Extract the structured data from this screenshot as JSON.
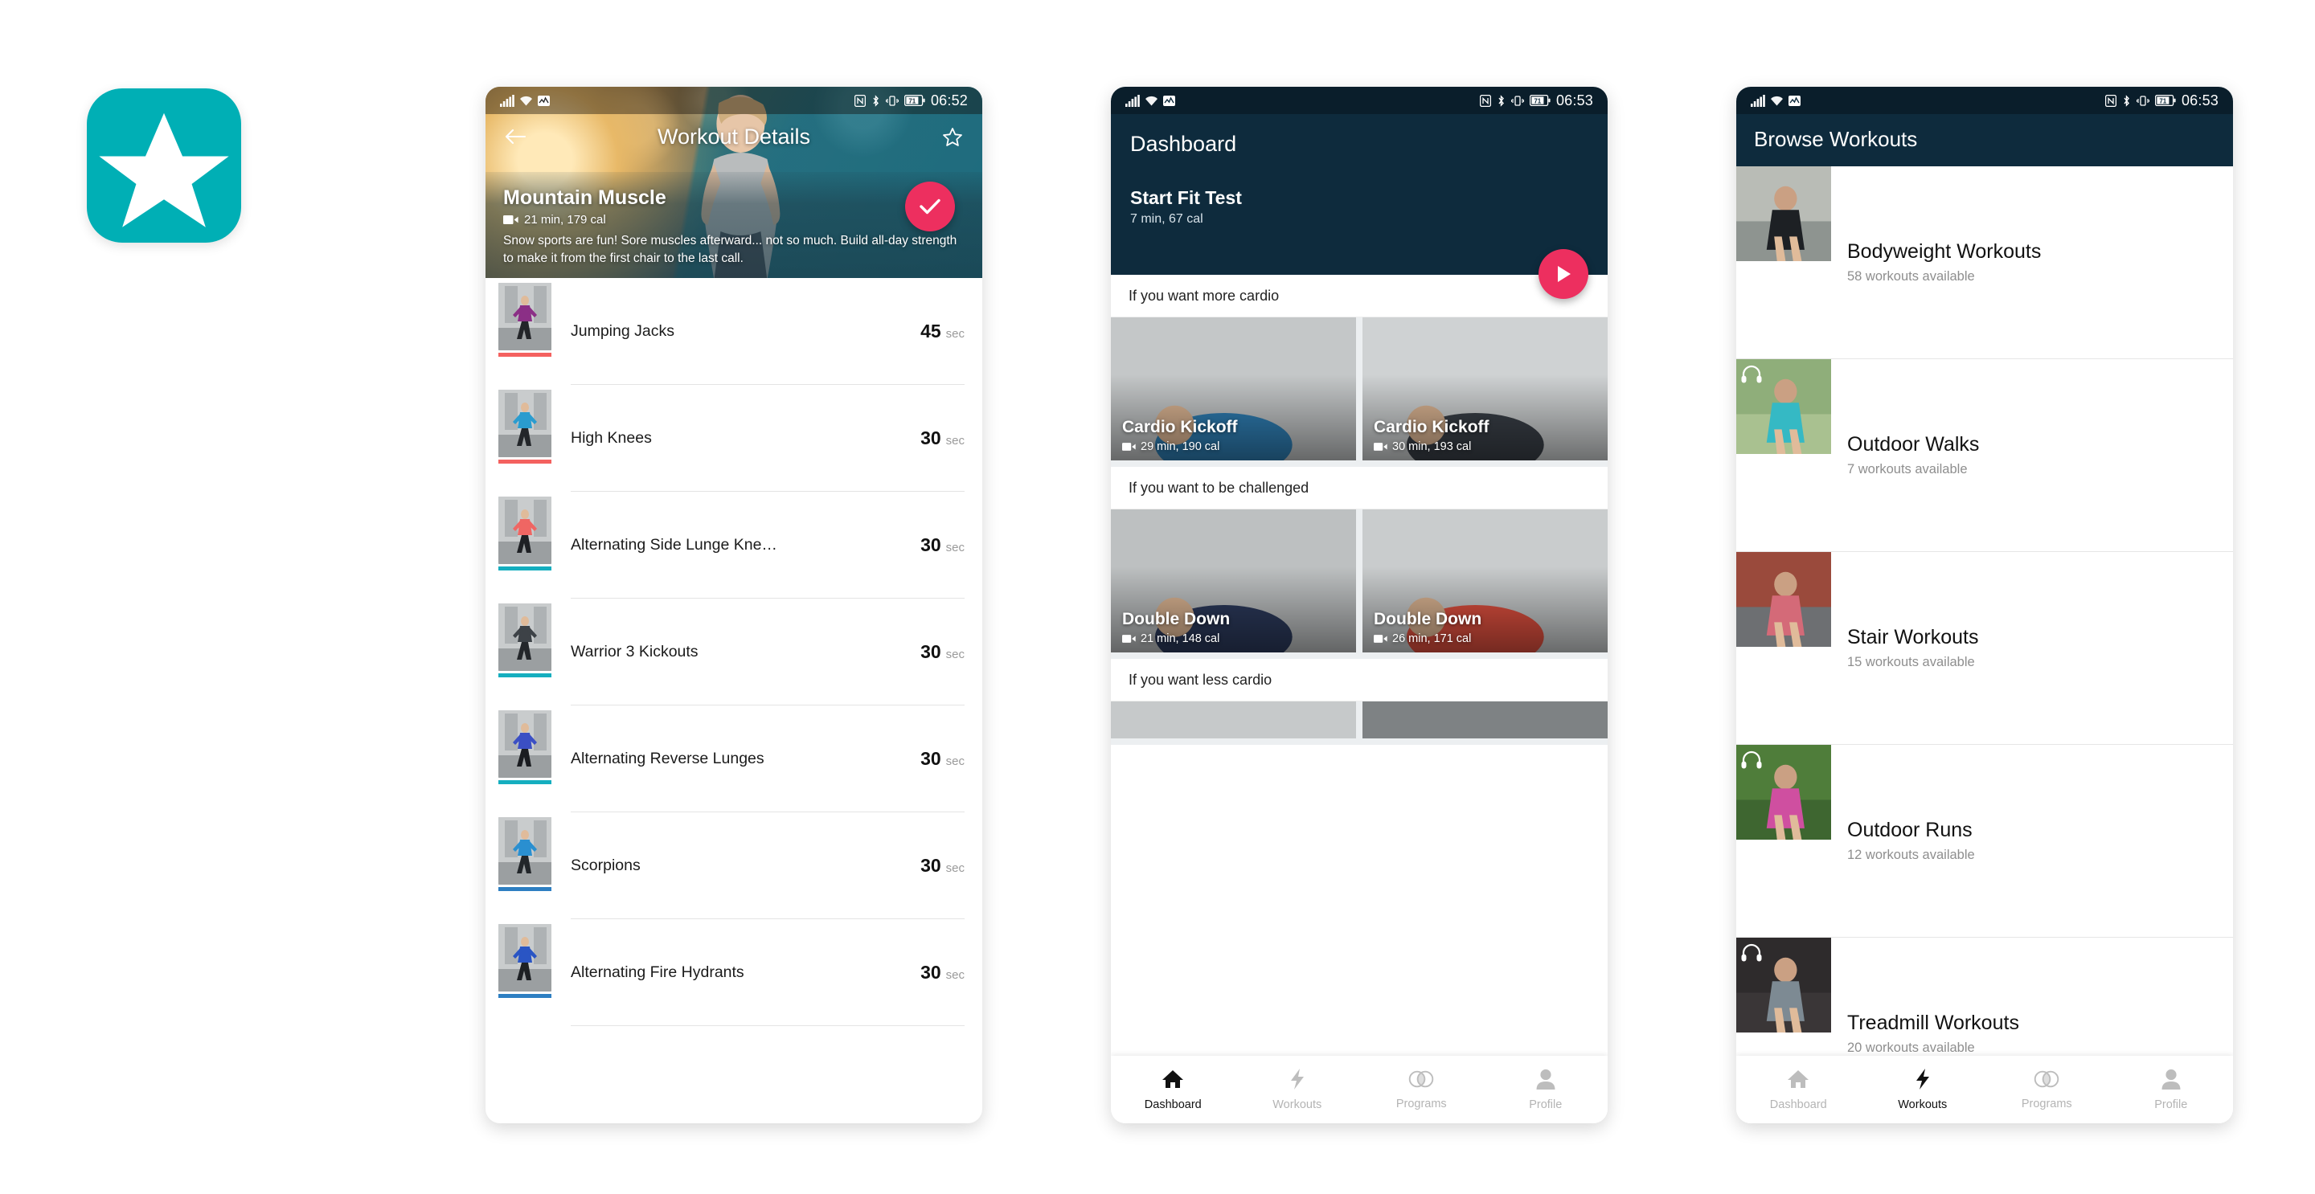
{
  "app_icon": {
    "name": "star-app-icon",
    "color": "#00AFB5",
    "glyph": "star"
  },
  "colors": {
    "accent_pink": "#ED2F5F",
    "navy": "#0E2B3D",
    "teal": "#00AFB5",
    "coral": "#F25B5B"
  },
  "phone1": {
    "status_bar": {
      "time": "06:52",
      "battery": "71",
      "icons": [
        "signal-icon",
        "wifi-icon",
        "data-icon",
        "nfc-icon",
        "bluetooth-icon",
        "vibrate-icon",
        "battery-icon"
      ]
    },
    "header": {
      "title": "Workout Details",
      "back": "back-arrow-icon",
      "favorite": "star-outline-icon"
    },
    "hero": {
      "name": "Mountain Muscle",
      "duration": "21 min, 179 cal",
      "description": "Snow sports are fun! Sore muscles afterward... not so much. Build all-day strength to make it from the first chair to the last call.",
      "fab": "check-icon"
    },
    "unit": "sec",
    "exercises": [
      {
        "name": "Jumping Jacks",
        "value": "45",
        "unit": "sec",
        "bar": "#F4615F"
      },
      {
        "name": "High Knees",
        "value": "30",
        "unit": "sec",
        "bar": "#F4615F"
      },
      {
        "name": "Alternating Side Lunge Kne…",
        "value": "30",
        "unit": "sec",
        "bar": "#15AEBF"
      },
      {
        "name": "Warrior 3 Kickouts",
        "value": "30",
        "unit": "sec",
        "bar": "#15AEBF"
      },
      {
        "name": "Alternating Reverse Lunges",
        "value": "30",
        "unit": "sec",
        "bar": "#15AEBF"
      },
      {
        "name": "Scorpions",
        "value": "30",
        "unit": "sec",
        "bar": "#2E7FC2"
      },
      {
        "name": "Alternating Fire Hydrants",
        "value": "30",
        "unit": "sec",
        "bar": "#2E7FC2"
      }
    ]
  },
  "phone2": {
    "status_bar": {
      "time": "06:53",
      "battery": "71"
    },
    "header": {
      "title": "Dashboard",
      "subtitle": "Start Fit Test",
      "meta": "7 min, 67 cal",
      "fab": "play-icon"
    },
    "sections": [
      {
        "label": "If you want more cardio",
        "cards": [
          {
            "name": "Cardio Kickoff",
            "meta": "29 min, 190 cal"
          },
          {
            "name": "Cardio Kickoff",
            "meta": "30 min, 193 cal"
          }
        ]
      },
      {
        "label": "If you want to be challenged",
        "cards": [
          {
            "name": "Double Down",
            "meta": "21 min, 148 cal"
          },
          {
            "name": "Double Down",
            "meta": "26 min, 171 cal"
          }
        ]
      },
      {
        "label": "If you want less cardio",
        "cards": []
      }
    ],
    "bottom_nav": {
      "active": "Dashboard",
      "items": [
        {
          "label": "Dashboard",
          "icon": "home-icon"
        },
        {
          "label": "Workouts",
          "icon": "bolt-icon"
        },
        {
          "label": "Programs",
          "icon": "venn-circles-icon"
        },
        {
          "label": "Profile",
          "icon": "person-icon"
        }
      ]
    }
  },
  "phone3": {
    "status_bar": {
      "time": "06:53",
      "battery": "71"
    },
    "header": {
      "title": "Browse Workouts"
    },
    "categories": [
      {
        "name": "Bodyweight Workouts",
        "count": "58 workouts available",
        "headphones": false
      },
      {
        "name": "Outdoor Walks",
        "count": "7 workouts available",
        "headphones": true
      },
      {
        "name": "Stair Workouts",
        "count": "15 workouts available",
        "headphones": false
      },
      {
        "name": "Outdoor Runs",
        "count": "12 workouts available",
        "headphones": true
      },
      {
        "name": "Treadmill Workouts",
        "count": "20 workouts available",
        "headphones": true
      }
    ],
    "bottom_nav": {
      "active": "Workouts",
      "items": [
        {
          "label": "Dashboard",
          "icon": "home-icon"
        },
        {
          "label": "Workouts",
          "icon": "bolt-icon"
        },
        {
          "label": "Programs",
          "icon": "venn-circles-icon"
        },
        {
          "label": "Profile",
          "icon": "person-icon"
        }
      ]
    }
  }
}
